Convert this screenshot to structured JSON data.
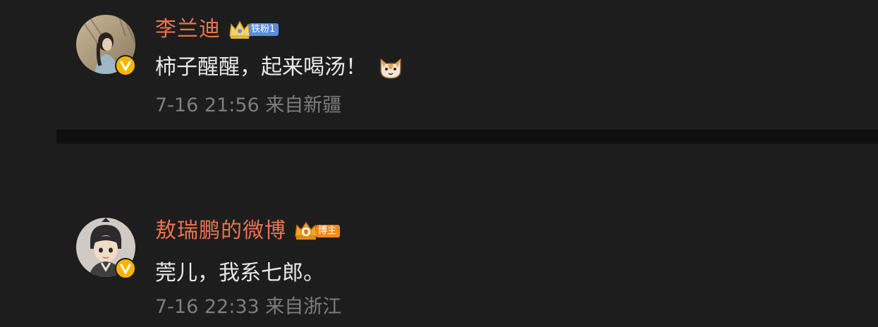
{
  "comments": [
    {
      "username": "李兰迪",
      "badge_label": "铁粉1",
      "text": "柿子醒醒，起来喝汤！",
      "emoji_icon": "cat-face-icon",
      "timestamp": "7-16 21:56",
      "location": "来自新疆"
    },
    {
      "username": "敖瑞鹏的微博",
      "badge_label": "博主",
      "text": "莞儿，我系七郎。",
      "timestamp": "7-16 22:33",
      "location": "来自浙江"
    }
  ],
  "colors": {
    "background": "#1d1d1d",
    "username": "#eb7350",
    "text": "#e8e8e8",
    "meta": "#7d7d7d",
    "verified": "#f7b500",
    "fan_badge": "#5c8dd9",
    "blogger_badge": "#f28b1c"
  }
}
